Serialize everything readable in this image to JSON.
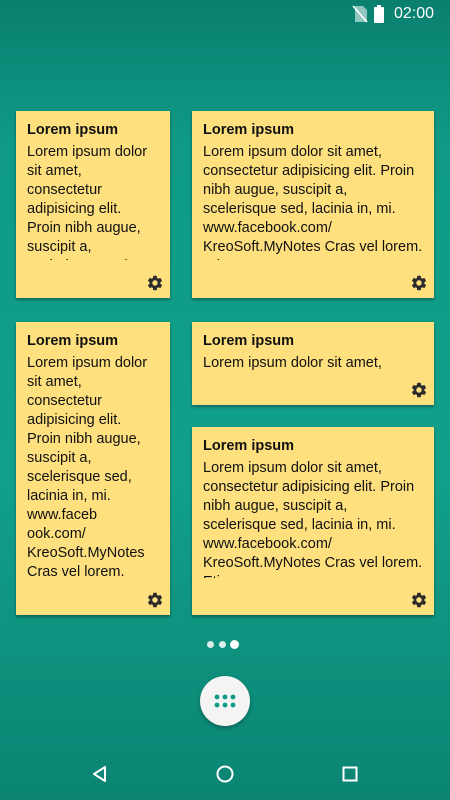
{
  "status_bar": {
    "time": "02:00",
    "icons": [
      "no-sim-icon",
      "battery-icon"
    ]
  },
  "notes": [
    {
      "title": "Lorem ipsum",
      "body": "Lorem ipsum dolor sit amet, consectetur adipisicing elit. Proin nibh augue, suscipit a, scelerisque sed,"
    },
    {
      "title": "Lorem ipsum",
      "body": "Lorem ipsum dolor sit amet, consectetur adipisicing elit. Proin nibh augue, suscipit a, scelerisque sed, lacinia in, mi. www.facebook.com/ KreoSoft.MyNotes Cras vel lorem. Etiam"
    },
    {
      "title": "Lorem ipsum",
      "body": "Lorem ipsum dolor sit amet, consectetur adipisicing elit. Proin nibh augue, suscipit a, scelerisque sed, lacinia in, mi. www.faceb ook.com/ KreoSoft.MyNotes Cras vel lorem."
    },
    {
      "title": "Lorem ipsum",
      "body": "Lorem ipsum dolor sit amet,"
    },
    {
      "title": "Lorem ipsum",
      "body": "Lorem ipsum dolor sit amet, consectetur adipisicing elit. Proin nibh augue, suscipit a, scelerisque sed, lacinia in, mi. www.facebook.com/ KreoSoft.MyNotes Cras vel lorem. Etiam"
    }
  ],
  "note_settings_icon": "gear-icon",
  "home": {
    "page_count": 3,
    "active_page": 3,
    "app_drawer_icon": "grid-dots-icon"
  },
  "nav_bar": {
    "icons": [
      "back-triangle-icon",
      "home-circle-icon",
      "recents-square-icon"
    ]
  },
  "colors": {
    "background": "#0e9a86",
    "note": "#ffe07f",
    "text": "#111111",
    "white": "#ffffff"
  }
}
